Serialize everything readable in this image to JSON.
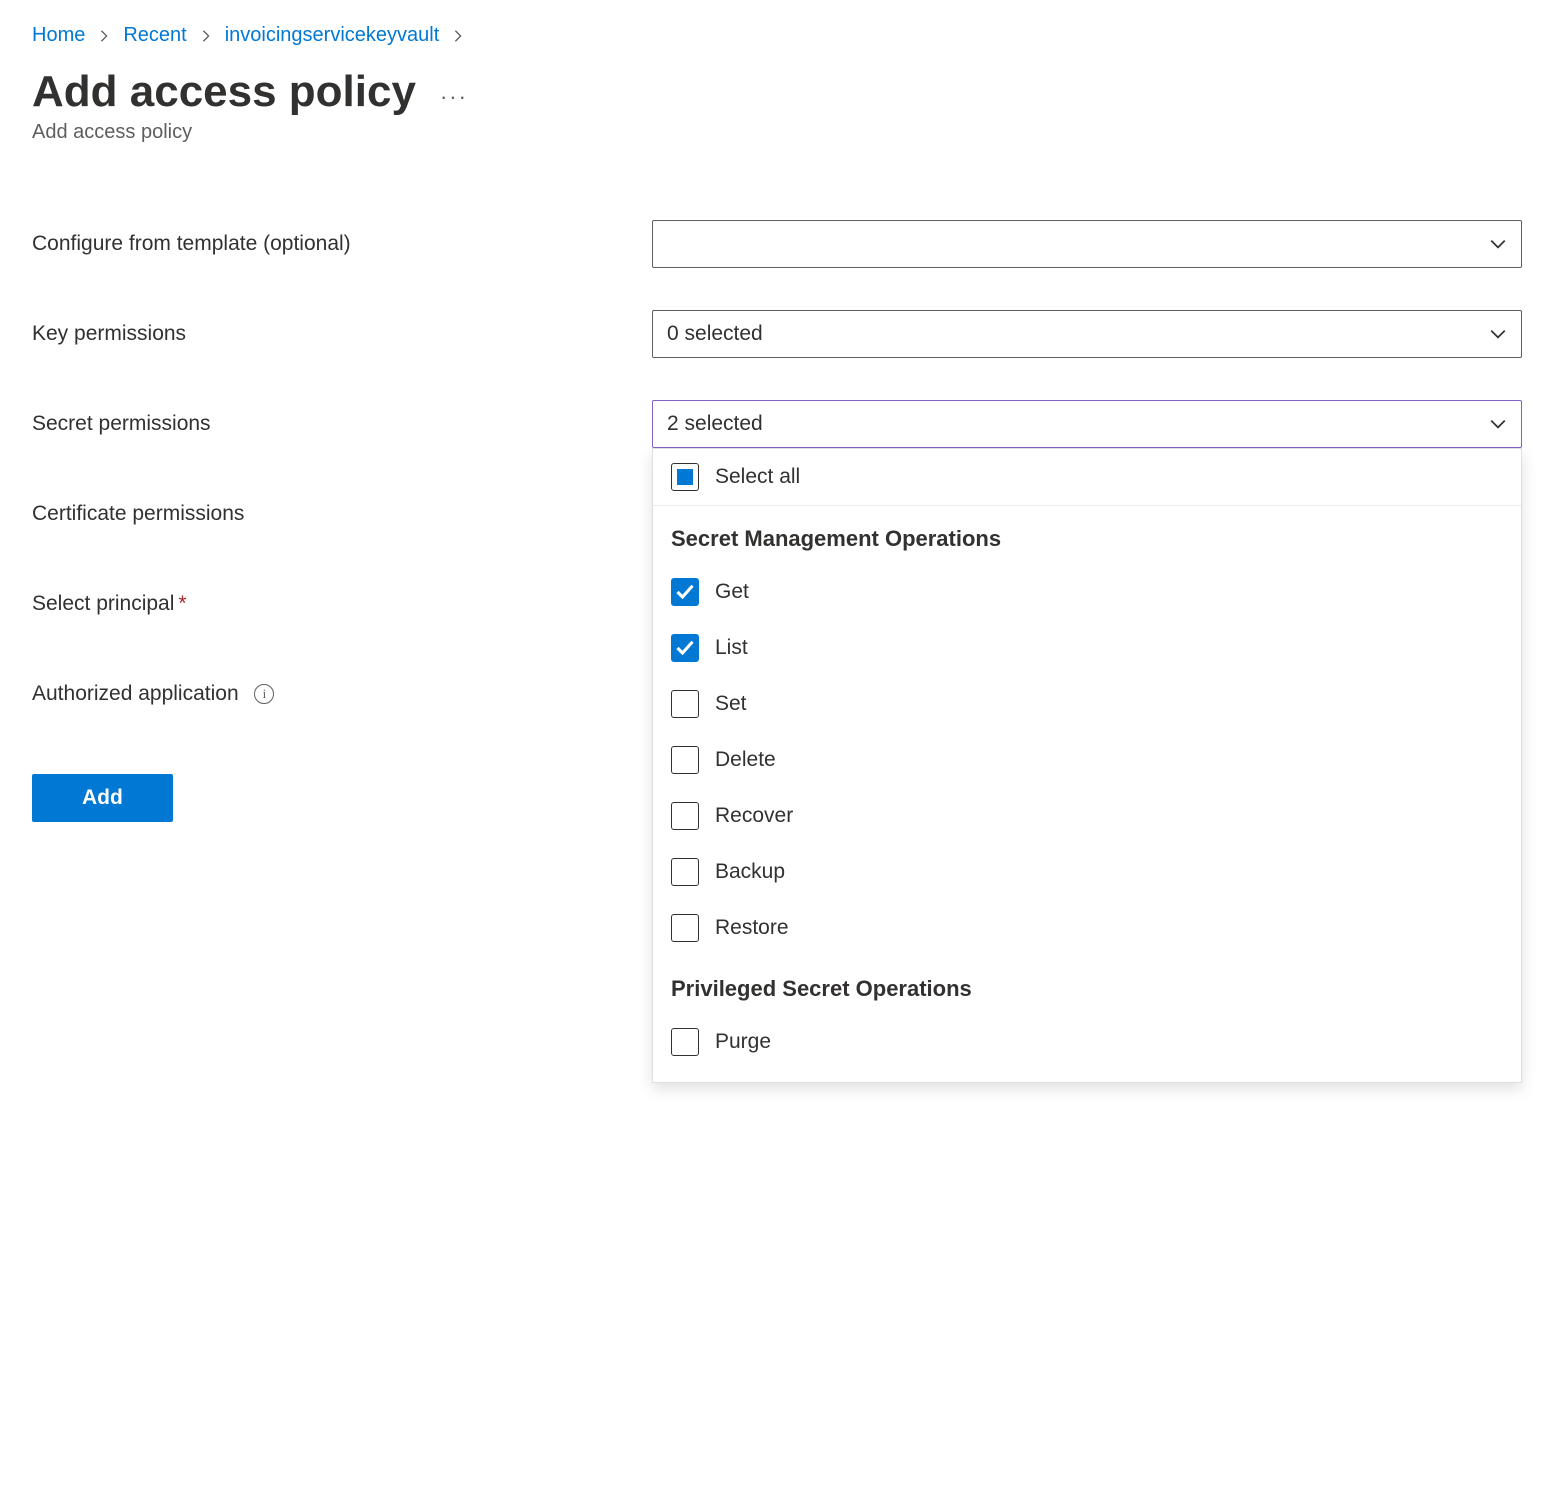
{
  "breadcrumb": [
    {
      "label": "Home"
    },
    {
      "label": "Recent"
    },
    {
      "label": "invoicingservicekeyvault"
    }
  ],
  "page": {
    "title": "Add access policy",
    "subtitle": "Add access policy"
  },
  "form": {
    "template": {
      "label": "Configure from template (optional)",
      "value": ""
    },
    "key_perm": {
      "label": "Key permissions",
      "value": "0 selected"
    },
    "secret_perm": {
      "label": "Secret permissions",
      "value": "2 selected"
    },
    "cert_perm": {
      "label": "Certificate permissions"
    },
    "principal": {
      "label": "Select principal"
    },
    "auth_app": {
      "label": "Authorized application"
    },
    "add_button": "Add"
  },
  "secret_dropdown": {
    "select_all": {
      "label": "Select all",
      "state": "mixed"
    },
    "groups": [
      {
        "heading": "Secret Management Operations",
        "items": [
          {
            "label": "Get",
            "checked": true
          },
          {
            "label": "List",
            "checked": true
          },
          {
            "label": "Set",
            "checked": false
          },
          {
            "label": "Delete",
            "checked": false
          },
          {
            "label": "Recover",
            "checked": false
          },
          {
            "label": "Backup",
            "checked": false
          },
          {
            "label": "Restore",
            "checked": false
          }
        ]
      },
      {
        "heading": "Privileged Secret Operations",
        "items": [
          {
            "label": "Purge",
            "checked": false
          }
        ]
      }
    ]
  }
}
